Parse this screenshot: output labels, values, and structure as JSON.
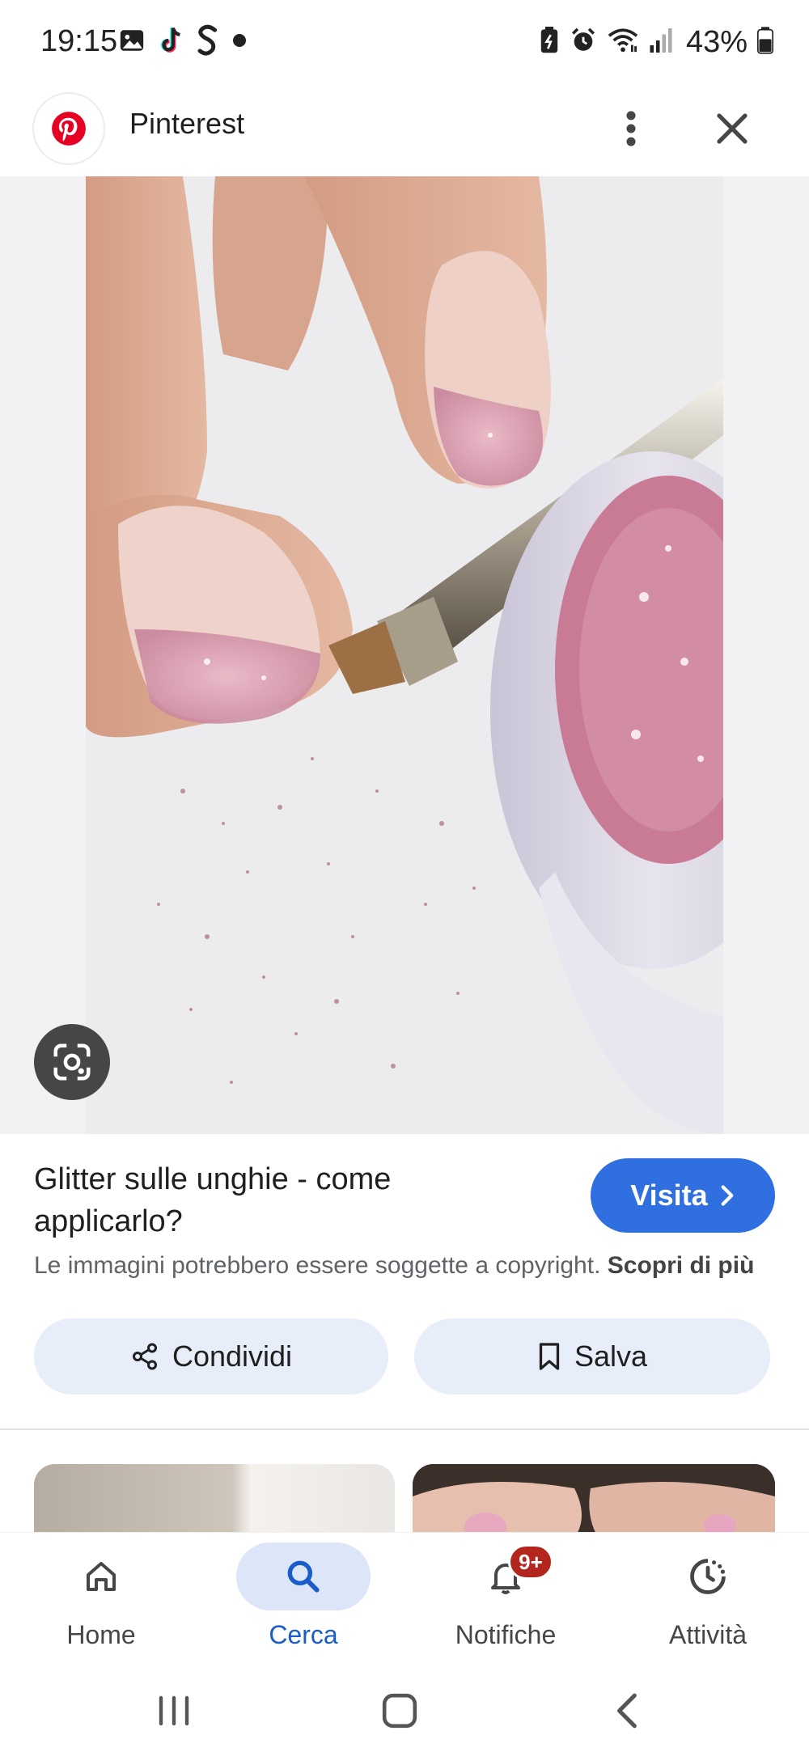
{
  "status_bar": {
    "time": "19:15",
    "battery_percent": "43%",
    "notification_icons": [
      "gallery-icon",
      "tiktok-icon",
      "s-app-icon",
      "dot-icon"
    ],
    "system_icons": [
      "battery-saver-icon",
      "alarm-icon",
      "wifi-icon",
      "signal-icon",
      "battery-icon"
    ]
  },
  "header": {
    "site_name": "Pinterest",
    "logo_icon": "pinterest-logo",
    "brand_color": "#e60023"
  },
  "image": {
    "lens_icon": "google-lens-icon"
  },
  "result": {
    "title": "Glitter sulle unghie - come applicarlo?",
    "visit_label": "Visita",
    "copyright_text": "Le immagini potrebbero essere soggette a copyright.",
    "copyright_link": "Scopri di più",
    "share_label": "Condividi",
    "save_label": "Salva",
    "accent_color": "#2f6fe0"
  },
  "bottom_nav": {
    "items": [
      {
        "label": "Home",
        "icon": "home-icon"
      },
      {
        "label": "Cerca",
        "icon": "search-icon",
        "active": true
      },
      {
        "label": "Notifiche",
        "icon": "bell-icon",
        "badge": "9+"
      },
      {
        "label": "Attività",
        "icon": "activity-icon"
      }
    ]
  },
  "system_nav": {
    "buttons": [
      "recents-button",
      "home-button",
      "back-button"
    ]
  }
}
